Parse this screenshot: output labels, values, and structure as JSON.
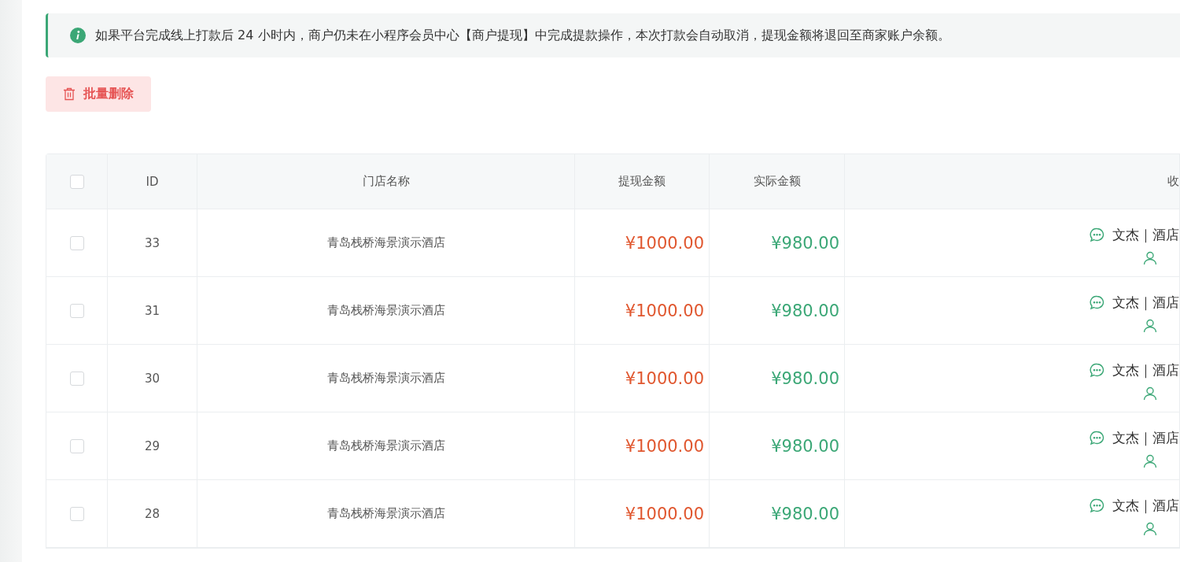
{
  "notice": {
    "text": "如果平台完成线上打款后 24 小时内，商户仍未在小程序会员中心【商户提现】中完成提款操作，本次打款会自动取消，提现金额将退回至商家账户余额。"
  },
  "batch_delete_button": {
    "label": "批量删除"
  },
  "table": {
    "columns": [
      {
        "kind": "check",
        "checked": false
      },
      {
        "kind": "text",
        "label": "ID"
      },
      {
        "kind": "text",
        "label": "门店名称"
      },
      {
        "kind": "text",
        "label": "提现金额"
      },
      {
        "kind": "text",
        "label": "实际金额"
      },
      {
        "kind": "text",
        "label": "收"
      }
    ],
    "rows": [
      {
        "checked": false,
        "id": "33",
        "store": "青岛栈桥海景演示酒店",
        "amount": "¥1000.00",
        "actual": "¥980.00",
        "payee": "文杰｜酒店"
      },
      {
        "checked": false,
        "id": "31",
        "store": "青岛栈桥海景演示酒店",
        "amount": "¥1000.00",
        "actual": "¥980.00",
        "payee": "文杰｜酒店"
      },
      {
        "checked": false,
        "id": "30",
        "store": "青岛栈桥海景演示酒店",
        "amount": "¥1000.00",
        "actual": "¥980.00",
        "payee": "文杰｜酒店"
      },
      {
        "checked": false,
        "id": "29",
        "store": "青岛栈桥海景演示酒店",
        "amount": "¥1000.00",
        "actual": "¥980.00",
        "payee": "文杰｜酒店"
      },
      {
        "checked": false,
        "id": "28",
        "store": "青岛栈桥海景演示酒店",
        "amount": "¥1000.00",
        "actual": "¥980.00",
        "payee": "文杰｜酒店"
      }
    ]
  }
}
